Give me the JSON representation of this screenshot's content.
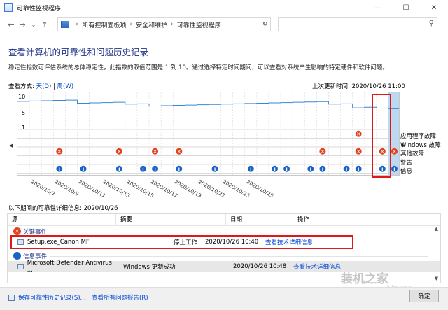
{
  "window": {
    "title": "可靠性监视程序",
    "minimize": "—",
    "maximize": "☐",
    "close": "✕"
  },
  "address": {
    "prefix": "«",
    "crumbs": [
      "所有控制面板项",
      "安全和维护",
      "可靠性监视程序"
    ],
    "sep": "›"
  },
  "page": {
    "heading": "查看计算机的可靠性和问题历史记录",
    "description": "稳定性指数可评估系统的总体稳定性，此指数的取值范围是 1 到 10。通过选择特定时间期间，可以查看对系统产生影响的特定硬件和软件问题。",
    "view_by_label": "查看方式:",
    "view_days": "天(D)",
    "view_sep": "|",
    "view_weeks": "周(W)",
    "last_update": "上次更新时间: 2020/10/26 11:00"
  },
  "chart_data": {
    "type": "line",
    "y_ticks": [
      "10",
      "5",
      "1"
    ],
    "ylim": [
      0,
      10
    ],
    "row_labels": [
      "应用程序故障",
      "Windows 故障",
      "其他故障",
      "警告",
      "信息"
    ],
    "dates": [
      "2020/10/7",
      "2020/10/9",
      "2020/10/11",
      "2020/10/13",
      "2020/10/15",
      "2020/10/17",
      "2020/10/19",
      "2020/10/21",
      "2020/10/23",
      "2020/10/25"
    ],
    "stability": [
      8.9,
      9.0,
      9.1,
      9.2,
      9.3,
      8.3,
      8.4,
      8.5,
      8.6,
      8.0,
      8.1,
      7.4,
      7.5,
      7.6,
      7.7,
      7.8,
      7.9,
      8.0,
      8.1,
      8.2,
      8.3,
      8.4,
      8.5,
      8.6,
      8.7,
      8.8,
      8.0,
      8.1,
      6.8,
      7.0,
      6.7,
      6.5
    ],
    "app_fault_days": [
      28
    ],
    "other_fault_days": [
      3,
      8,
      11,
      13,
      25,
      28,
      30,
      31
    ],
    "info_days": [
      3,
      5,
      8,
      10,
      11,
      13,
      16,
      19,
      21,
      22,
      24,
      25,
      27,
      28,
      30,
      31
    ],
    "selected_day": 31
  },
  "list_label": "以下期间的可靠性详细信息: 2020/10/26",
  "table": {
    "headers": [
      "源",
      "摘要",
      "日期",
      "操作"
    ],
    "groups": [
      {
        "title": "关键事件",
        "rows": [
          {
            "source": "Setup.exe_Canon MF",
            "summary": "停止工作",
            "date": "2020/10/26 10:40",
            "action": "查看技术详细信息"
          }
        ]
      },
      {
        "title": "信息事件",
        "rows": [
          {
            "source": "Microsoft Defender Antivirus ...",
            "summary": "Windows 更新成功",
            "date": "2020/10/26 10:48",
            "action": "查看技术详细信息"
          }
        ]
      }
    ]
  },
  "footer": {
    "save_link": "保存可靠性历史记录(S)...",
    "reports_link": "查看所有问题报告(R)",
    "ok": "确定"
  },
  "watermark": {
    "text": "装机之家",
    "sub": "lotpc.com"
  },
  "colors": {
    "accent": "#1e3287",
    "link": "#0046d5",
    "error": "#e0421f",
    "info": "#1a62c7",
    "highlight": "#e01818"
  }
}
